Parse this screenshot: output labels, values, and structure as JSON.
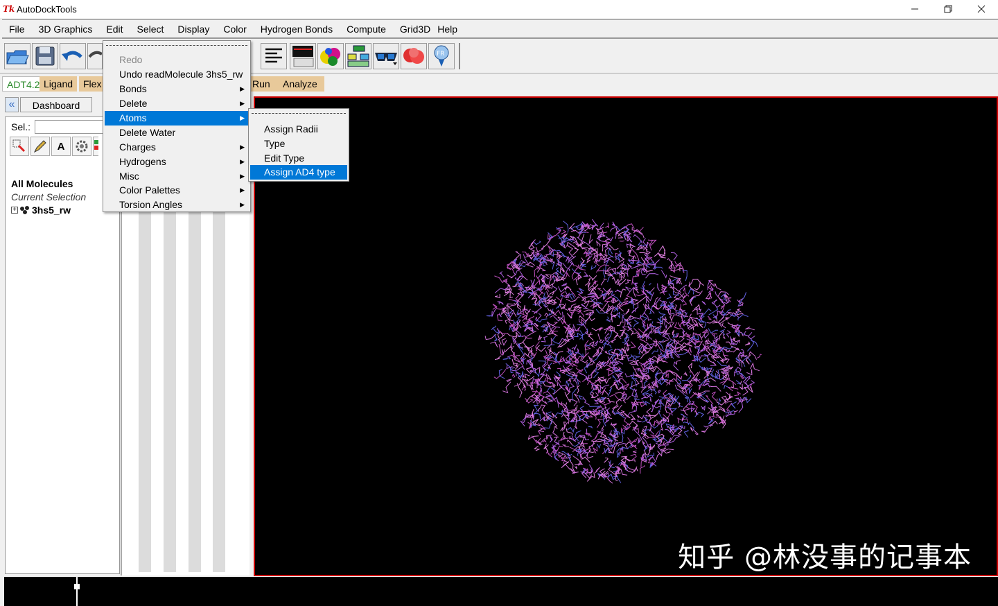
{
  "window": {
    "title": "AutoDockTools",
    "app_icon": "Tk"
  },
  "menubar": {
    "items": [
      "File",
      "3D Graphics",
      "Edit",
      "Select",
      "Display",
      "Color",
      "Hydrogen Bonds",
      "Compute",
      "Grid3D",
      "Help"
    ]
  },
  "module_tabs": [
    "ADT4.2",
    "Ligand",
    "Flex",
    "Run",
    "Analyze"
  ],
  "left_panel": {
    "dashboard_label": "Dashboard",
    "sel_label": "Sel.:",
    "sel_value": "",
    "all_molecules": "All Molecules",
    "current_selection": "Current Selection",
    "molecule_name": "3hs5_rw",
    "tool_a_label": "A"
  },
  "edit_menu": {
    "items": [
      {
        "label": "Redo",
        "disabled": true,
        "submenu": false
      },
      {
        "label": "Undo readMolecule 3hs5_rw",
        "disabled": false,
        "submenu": false
      },
      {
        "label": "Bonds",
        "disabled": false,
        "submenu": true
      },
      {
        "label": "Delete",
        "disabled": false,
        "submenu": true
      },
      {
        "label": "Atoms",
        "disabled": false,
        "submenu": true,
        "highlighted": true
      },
      {
        "label": "Delete Water",
        "disabled": false,
        "submenu": false
      },
      {
        "label": "Charges",
        "disabled": false,
        "submenu": true
      },
      {
        "label": "Hydrogens",
        "disabled": false,
        "submenu": true
      },
      {
        "label": "Misc",
        "disabled": false,
        "submenu": true
      },
      {
        "label": "Color Palettes",
        "disabled": false,
        "submenu": true
      },
      {
        "label": "Torsion Angles",
        "disabled": false,
        "submenu": true
      }
    ]
  },
  "atoms_submenu": {
    "items": [
      "Assign Radii",
      "Type",
      "Edit Type",
      "Assign AD4 type"
    ],
    "highlighted": "Assign AD4 type"
  },
  "viewer": {
    "watermark": "知乎 @林没事的记事本",
    "molecule_color": "#d070d8",
    "background": "#000000",
    "border_color": "#cc0000"
  },
  "accent_color": "#0078d7"
}
